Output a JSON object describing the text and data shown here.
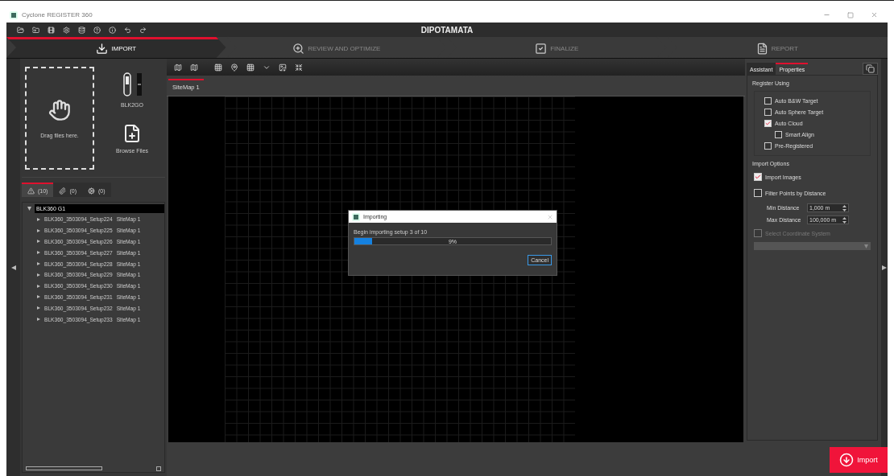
{
  "window": {
    "title": "Cyclone REGISTER 360"
  },
  "project": {
    "title": "DIPOTAMATA"
  },
  "steps": [
    {
      "label": "IMPORT",
      "selected": true
    },
    {
      "label": "REVIEW AND OPTIMIZE",
      "selected": false
    },
    {
      "label": "FINALIZE",
      "selected": false
    },
    {
      "label": "REPORT",
      "selected": false
    }
  ],
  "import_panel": {
    "drop_hint": "Drag files here.",
    "device": "BLK2GO",
    "browse": "Browse Files"
  },
  "source_tabs": [
    {
      "kind": "warning",
      "label": "(10)",
      "selected": true
    },
    {
      "kind": "attachment",
      "label": "(0)",
      "selected": false
    },
    {
      "kind": "settings",
      "label": "(0)",
      "selected": false
    }
  ],
  "tree": {
    "label": "BLK360 G1",
    "expanded": true,
    "children": [
      {
        "name": "BLK360_3503094_Setup224",
        "sitemap": "SiteMap 1",
        "expanded": false
      },
      {
        "name": "BLK360_3503094_Setup225",
        "sitemap": "SiteMap 1",
        "expanded": false
      },
      {
        "name": "BLK360_3503094_Setup226",
        "sitemap": "SiteMap 1",
        "expanded": false
      },
      {
        "name": "BLK360_3503094_Setup227",
        "sitemap": "SiteMap 1",
        "expanded": false
      },
      {
        "name": "BLK360_3503094_Setup228",
        "sitemap": "SiteMap 1",
        "expanded": false
      },
      {
        "name": "BLK360_3503094_Setup229",
        "sitemap": "SiteMap 1",
        "expanded": false
      },
      {
        "name": "BLK360_3503094_Setup230",
        "sitemap": "SiteMap 1",
        "expanded": false
      },
      {
        "name": "BLK360_3503094_Setup231",
        "sitemap": "SiteMap 1",
        "expanded": false
      },
      {
        "name": "BLK360_3503094_Setup232",
        "sitemap": "SiteMap 1",
        "expanded": false
      },
      {
        "name": "BLK360_3503094_Setup233",
        "sitemap": "SiteMap 1",
        "expanded": false
      }
    ]
  },
  "map_tabs": [
    {
      "label": "SiteMap 1",
      "selected": true
    }
  ],
  "dialog": {
    "title": "Importing",
    "message": "Begin importing setup 3 of 10",
    "level": 0.09,
    "percent": "9%",
    "button": "Cancel"
  },
  "side_tabs": [
    {
      "label": "Assistant",
      "selected": false
    },
    {
      "label": "Properties",
      "selected": true
    }
  ],
  "register_using": {
    "title": "Register Using",
    "options": [
      {
        "label": "Auto B&W Target",
        "checked": false
      },
      {
        "label": "Auto Sphere Target",
        "checked": false
      },
      {
        "label": "Auto Cloud",
        "checked": true,
        "children": [
          {
            "label": "Smart Align",
            "checked": false
          }
        ]
      },
      {
        "label": "Pre-Registered",
        "checked": false
      }
    ]
  },
  "import_options": {
    "title": "Import Options",
    "import_images": {
      "label": "Import Images",
      "checked": true
    },
    "filter": {
      "label": "Filter Points by Distance",
      "checked": false
    },
    "distances": [
      {
        "label": "Min Distance",
        "value": "1,000 m"
      },
      {
        "label": "Max Distance",
        "value": "100,000 m"
      }
    ],
    "coordinate": {
      "label": "Select Coordinate System",
      "checked": false,
      "disabled": true
    }
  },
  "import_button": "Import"
}
